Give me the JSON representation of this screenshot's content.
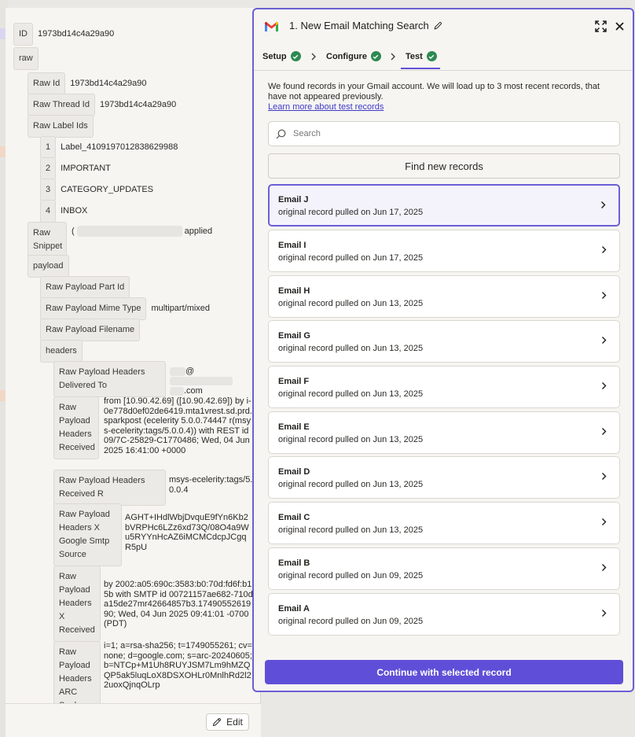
{
  "left": {
    "id_label": "ID",
    "id_value": "1973bd14c4a29a90",
    "raw_label": "raw",
    "raw_id_label": "Raw Id",
    "raw_id_value": "1973bd14c4a29a90",
    "raw_thread_label": "Raw Thread Id",
    "raw_thread_value": "1973bd14c4a29a90",
    "raw_label_ids_label": "Raw Label Ids",
    "label_ids": [
      {
        "index": "1",
        "value": "Label_4109197012838629988"
      },
      {
        "index": "2",
        "value": "IMPORTANT"
      },
      {
        "index": "3",
        "value": "CATEGORY_UPDATES"
      },
      {
        "index": "4",
        "value": "INBOX"
      }
    ],
    "snippet_label": "Raw Snippet",
    "snippet_prefix": "(",
    "snippet_suffix": "applied",
    "payload_label": "payload",
    "part_id_label": "Raw Payload Part Id",
    "mime_label": "Raw Payload Mime Type",
    "mime_value": "multipart/mixed",
    "filename_label": "Raw Payload Filename",
    "headers_label": "headers",
    "delivered_label": "Raw Payload Headers Delivered To",
    "delivered_value_at": "@",
    "delivered_value_com": ".com",
    "received_label": "Raw Payload Headers Received",
    "received_value": "from [10.90.42.69] ([10.90.42.69]) by i-0e778d0ef02de6419.mta1vrest.sd.prd.sparkpost (ecelerity 5.0.0.74447 r(msys-ecelerity:tags/5.0.0.4)) with REST id 09/7C-25829-C1770486; Wed, 04 Jun 2025 16:41:00 +0000",
    "received_r_label": "Raw Payload Headers Received R",
    "received_r_value": "msys-ecelerity:tags/5.0.0.4",
    "smtp_label": "Raw Payload Headers X Google Smtp Source",
    "smtp_value": "AGHT+IHdlWbjDvquE9fYn6Kb2bVRPHc6LZz6xd73Q/08O4a9Wu5RYYnHcAZ6iMCMCdcpJCgqR5pU",
    "xreceived_label": "Raw Payload Headers X Received",
    "xreceived_value": "by 2002:a05:690c:3583:b0:70d:fd6f:b15b with SMTP id 00721157ae682-710da15de27mr42664857b3.1749055261990;        Wed, 04 Jun 2025 09:41:01 -0700 (PDT)",
    "arc_label": "Raw Payload Headers ARC Seal",
    "arc_value": "i=1; a=rsa-sha256; t=1749055261; cv=none;        d=google.com; s=arc-20240605; b=NTCp+M1Uh8RUYJSM7Lm9hMZQQP5ak5luqLoX8DSXOHLr0MnlhRd2l22uoxQjnqOLrp",
    "edit_label": "Edit"
  },
  "right": {
    "title": "1. New Email Matching Search",
    "tabs": [
      {
        "label": "Setup"
      },
      {
        "label": "Configure"
      },
      {
        "label": "Test"
      }
    ],
    "intro": "We found records in your Gmail account. We will load up to 3 most recent records, that have not appeared previously.",
    "learn_more": "Learn more about test records",
    "search_placeholder": "Search",
    "find_label": "Find new records",
    "records": [
      {
        "name": "Email J",
        "sub": "original record pulled on Jun 17, 2025"
      },
      {
        "name": "Email I",
        "sub": "original record pulled on Jun 17, 2025"
      },
      {
        "name": "Email H",
        "sub": "original record pulled on Jun 13, 2025"
      },
      {
        "name": "Email G",
        "sub": "original record pulled on Jun 13, 2025"
      },
      {
        "name": "Email F",
        "sub": "original record pulled on Jun 13, 2025"
      },
      {
        "name": "Email E",
        "sub": "original record pulled on Jun 13, 2025"
      },
      {
        "name": "Email D",
        "sub": "original record pulled on Jun 13, 2025"
      },
      {
        "name": "Email C",
        "sub": "original record pulled on Jun 13, 2025"
      },
      {
        "name": "Email B",
        "sub": "original record pulled on Jun 09, 2025"
      },
      {
        "name": "Email A",
        "sub": "original record pulled on Jun 09, 2025"
      }
    ],
    "continue_label": "Continue with selected record"
  },
  "colors": {
    "accent": "#5f4fd8",
    "selected_border": "#6a5fd6",
    "success": "#2e8a52",
    "panel_bg": "#f6f5f1"
  },
  "icons": [
    "gmail-logo-icon",
    "pencil-icon",
    "expand-icon",
    "close-icon",
    "check-icon",
    "chevron-right-icon",
    "search-icon"
  ]
}
